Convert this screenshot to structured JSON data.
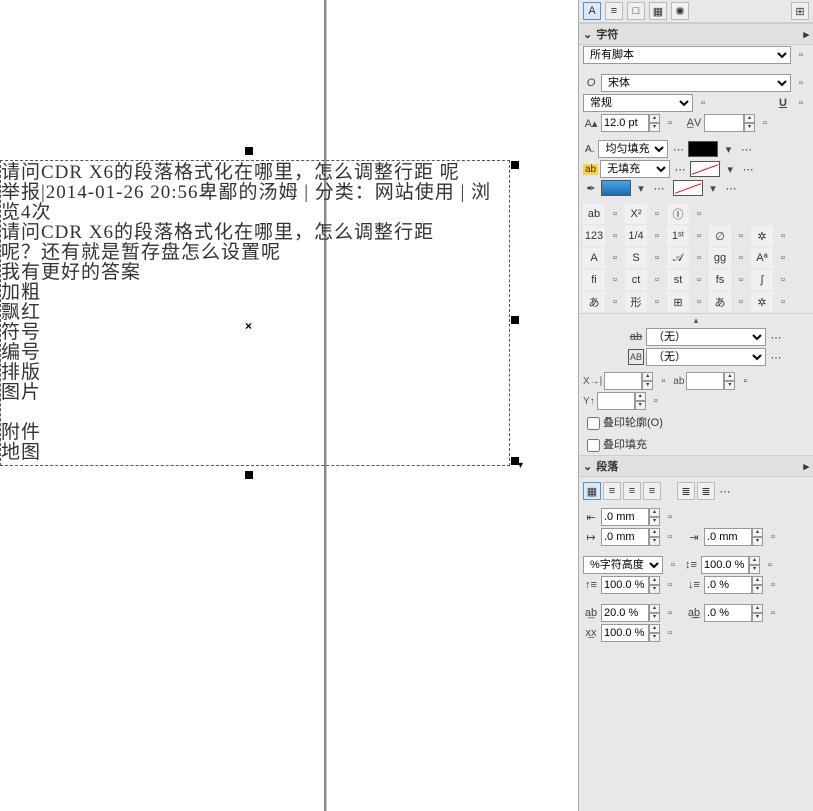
{
  "canvas": {
    "text": "请问CDR X6的段落格式化在哪里，怎么调整行距 呢\n举报|2014-01-26 20:56卑鄙的汤姆 | 分类：网站使用 | 浏览4次\n请问CDR X6的段落格式化在哪里，怎么调整行距\n呢？还有就是暂存盘怎么设置呢\n我有更好的答案\n加粗\n飘红\n符号\n编号\n排版\n图片\n\n附件\n地图"
  },
  "panel": {
    "char_title": "字符",
    "script_select": "所有脚本",
    "font_family": "宋体",
    "font_style": "常规",
    "font_size": "12.0 pt",
    "fill_type": "均匀填充",
    "fill_type2": "无填充",
    "ruby_none1": "（无）",
    "ruby_none2": "（无）",
    "xoffset": "",
    "yoffset": "",
    "overprint_outline": "叠印轮廓(O)",
    "overprint_fill": "叠印填充",
    "para_title": "段落",
    "indent_left": ".0 mm",
    "indent_left2": ".0 mm",
    "indent_right": ".0 mm",
    "line_mode": "%字符高度",
    "line_height": "100.0 %",
    "before": "100.0 %",
    "after": ".0 %",
    "char_sp": "20.0 %",
    "word_sp": ".0 %",
    "lang_sp": "100.0 %"
  }
}
